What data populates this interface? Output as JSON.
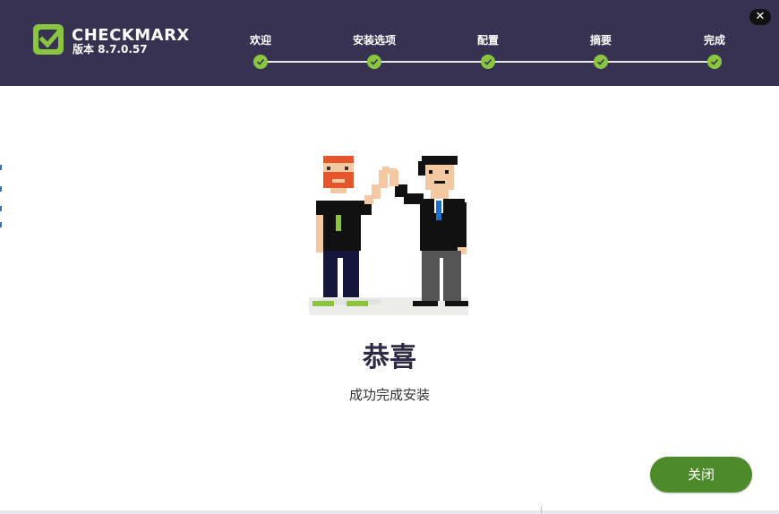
{
  "header": {
    "brand": "CHECKMARX",
    "version": "版本 8.7.0.57",
    "close_glyph": "✕"
  },
  "steps": [
    {
      "label": "欢迎",
      "status": "done"
    },
    {
      "label": "安装选项",
      "status": "done"
    },
    {
      "label": "配置",
      "status": "done"
    },
    {
      "label": "摘要",
      "status": "done"
    },
    {
      "label": "完成",
      "status": "done"
    }
  ],
  "main": {
    "title": "恭喜",
    "subtitle": "成功完成安装",
    "close_button": "关闭"
  },
  "colors": {
    "header_bg": "#373252",
    "accent_green": "#8bc540",
    "button_green": "#4d8a2a"
  }
}
